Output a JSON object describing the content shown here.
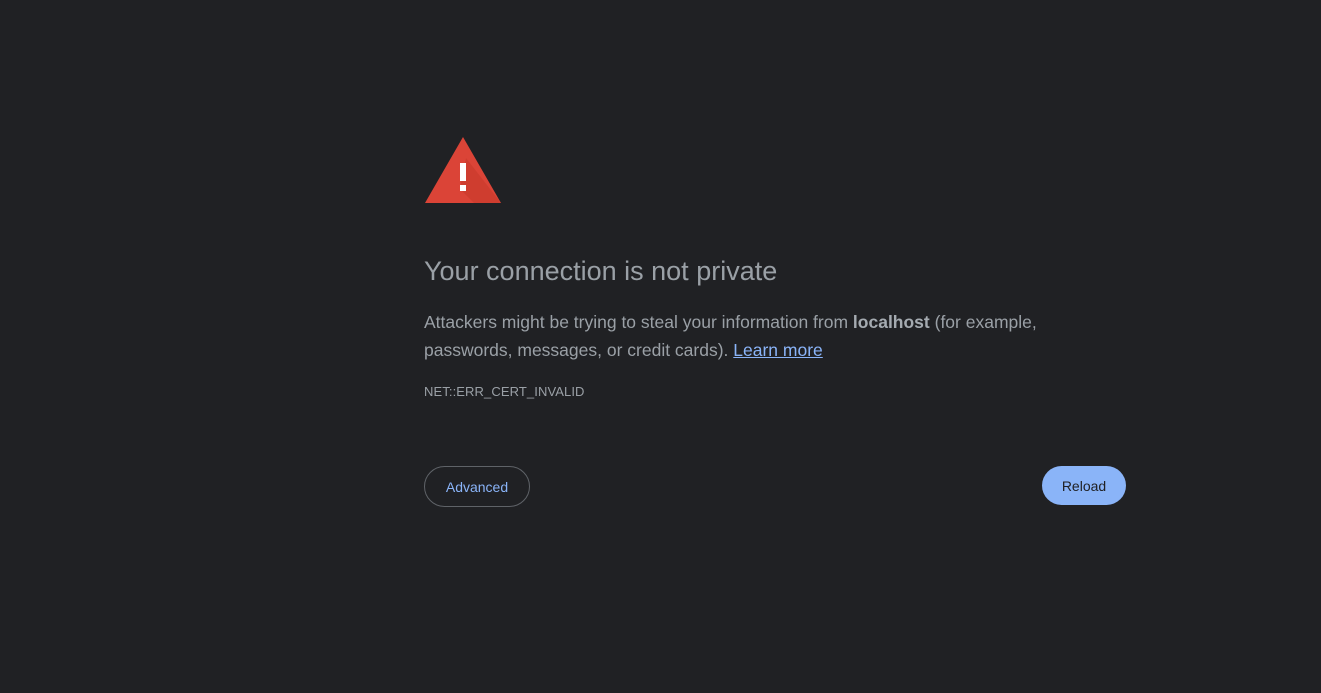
{
  "interstitial": {
    "heading": "Your connection is not private",
    "explanation_before": "Attackers might be trying to steal your information from ",
    "host": "localhost",
    "explanation_after": " (for example, passwords, messages, or credit cards). ",
    "learn_more_label": "Learn more",
    "error_code": "NET::ERR_CERT_INVALID",
    "advanced_label": "Advanced",
    "reload_label": "Reload"
  },
  "icons": {
    "warning": "warning-triangle-icon"
  },
  "colors": {
    "background": "#202124",
    "text": "#9aa0a6",
    "link": "#8ab4f8",
    "warning_red": "#db4437",
    "reload_button": "#8ab4f8"
  }
}
